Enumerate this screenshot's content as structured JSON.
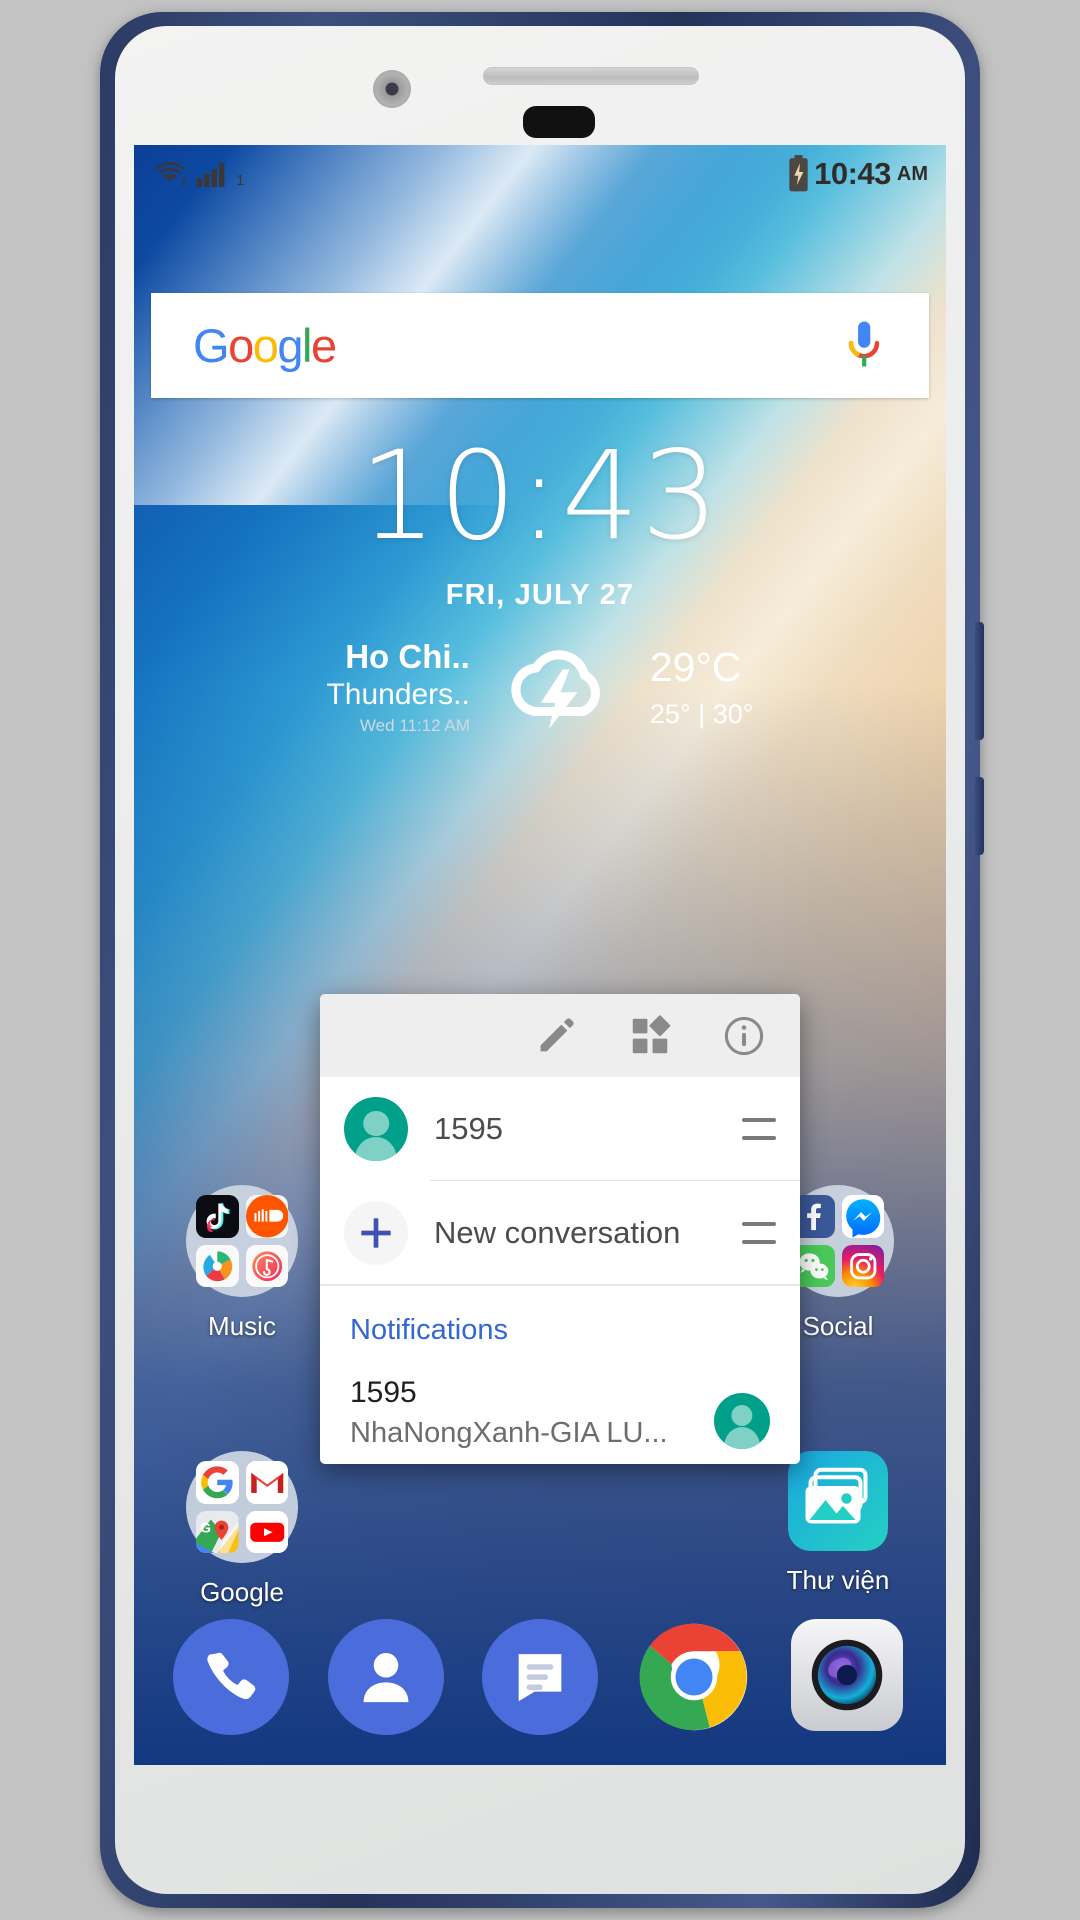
{
  "device": {
    "frame_color": "#2b3a63",
    "body_color": "#eceded"
  },
  "status_bar": {
    "wifi_icon": "wifi-icon",
    "signal_icon": "cellular-signal-icon",
    "sim_number": "1",
    "battery_icon": "battery-charging-icon",
    "time": "10:43",
    "am_pm": "AM"
  },
  "search": {
    "logo_text": "Google",
    "logo_letters": [
      "G",
      "o",
      "o",
      "g",
      "l",
      "e"
    ],
    "mic_icon": "microphone-icon"
  },
  "clock": {
    "time": "10:43",
    "date": "FRI, JULY 27"
  },
  "weather": {
    "city": "Ho Chi..",
    "condition": "Thunders..",
    "updated": "Wed 11:12 AM",
    "icon": "thunderstorm-cloud-icon",
    "temperature": "29°C",
    "range": "25° | 30°"
  },
  "popup": {
    "toolbar": {
      "edit_icon": "pencil-edit-icon",
      "widgets_icon": "widgets-grid-icon",
      "info_icon": "info-circle-icon"
    },
    "shortcuts": [
      {
        "label": "1595",
        "avatar": "contact-avatar-green",
        "handle": "drag-handle-icon"
      },
      {
        "label": "New conversation",
        "avatar": "plus-icon",
        "handle": "drag-handle-icon"
      }
    ],
    "notifications_header": "Notifications",
    "notification": {
      "title": "1595",
      "body": "NhaNongXanh-GIA LU...",
      "avatar": "contact-avatar-green"
    },
    "accent_color": "#3367d6"
  },
  "home_screen": {
    "folders": [
      {
        "name": "Music",
        "apps": [
          "tiktok-icon",
          "soundcloud-icon",
          "spotify-icon",
          "music-player-icon"
        ]
      },
      {
        "name": "Social",
        "apps": [
          "facebook-icon",
          "messenger-icon",
          "wechat-icon",
          "instagram-icon"
        ]
      },
      {
        "name": "Google",
        "apps": [
          "google-search-icon",
          "gmail-icon",
          "google-maps-icon",
          "youtube-icon"
        ]
      }
    ],
    "apps": [
      {
        "name": "Thư viện",
        "icon": "gallery-icon"
      }
    ]
  },
  "dock": {
    "items": [
      {
        "name": "Phone",
        "icon": "phone-icon"
      },
      {
        "name": "Contacts",
        "icon": "contacts-icon"
      },
      {
        "name": "Messages",
        "icon": "messages-icon"
      },
      {
        "name": "Chrome",
        "icon": "chrome-icon"
      },
      {
        "name": "Camera",
        "icon": "camera-icon"
      }
    ]
  },
  "colors": {
    "google_blue": "#4285F4",
    "google_red": "#EA4335",
    "google_yellow": "#FBBC05",
    "google_green": "#34A853",
    "avatar_green": "#00a08a",
    "dock_blue": "#4a6ddb"
  }
}
